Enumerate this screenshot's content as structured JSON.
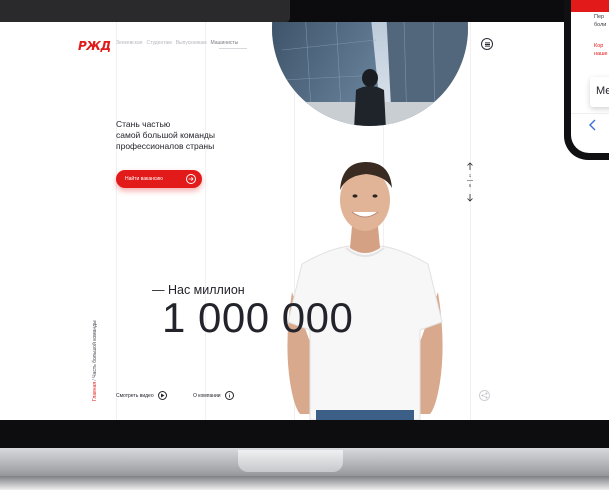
{
  "site": {
    "logo_text": "РЖД",
    "nav": [
      {
        "label": "Зенкевская",
        "active": false
      },
      {
        "label": "Студентам",
        "active": false
      },
      {
        "label": "Выпускникам",
        "active": false
      },
      {
        "label": "Машинисты",
        "active": true
      }
    ],
    "menu_icon": "hamburger-icon",
    "headline_lines": [
      "Стань частью",
      "самой большой команды",
      "профессионалов страны"
    ],
    "cta_label": "Найти вакансию",
    "cta_icon": "arrow-right-icon",
    "pager": {
      "current": "1",
      "total": "6"
    },
    "count_label": "— Нас миллион",
    "count_value": "1 000 000",
    "breadcrumb": {
      "home": "Главная",
      "separator": "/",
      "current": "Часть большой команды"
    },
    "video_link": "Смотреть видео",
    "about_link": "О компании",
    "share_icon": "share-icon"
  },
  "phone": {
    "line1": "Пер",
    "line2": "боли",
    "line3": "Кор",
    "line4": "наше",
    "field_text": "Ме"
  },
  "colors": {
    "brand_red": "#e21a1a",
    "text_dark": "#23232b",
    "bezel": "#0c0c0e"
  }
}
